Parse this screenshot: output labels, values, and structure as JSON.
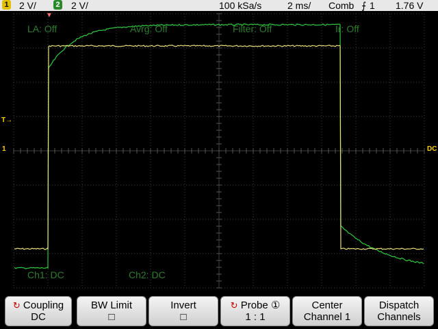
{
  "status_bar": {
    "ch1_number": "1",
    "ch1_scale": "2 V/",
    "ch2_number": "2",
    "ch2_scale": "2 V/",
    "sample_rate": "100 kSa/s",
    "timebase": "2 ms/",
    "acq_mode": "Comb",
    "trigger_channel": "1",
    "trigger_level": "1.76 V"
  },
  "overlays": {
    "la": "LA: Off",
    "avrg": "Avrg: Off",
    "filter": "Filter: Off",
    "ir": "Ir: Off",
    "ch1_coupling": "Ch1: DC",
    "ch2_coupling": "Ch2: DC"
  },
  "markers": {
    "trigger_time": "▼",
    "trigger_level": "T→",
    "ch1_ground": "1",
    "dc_right": "DC"
  },
  "softkeys": [
    {
      "line1": "Coupling",
      "line2": "DC",
      "rotate_icon": "↻"
    },
    {
      "line1": "BW Limit",
      "line2": "□"
    },
    {
      "line1": "Invert",
      "line2": "□"
    },
    {
      "line1": "Probe ①",
      "line2": "1 : 1",
      "rotate_icon": "↻"
    },
    {
      "line1": "Center",
      "line2": "Channel 1"
    },
    {
      "line1": "Dispatch",
      "line2": "Channels"
    }
  ],
  "colors": {
    "ch1_trace": "#e8e07a",
    "ch2_trace": "#2ecc40",
    "grid": "#3f3f3f",
    "overlay_text": "#2e7d2e"
  }
}
